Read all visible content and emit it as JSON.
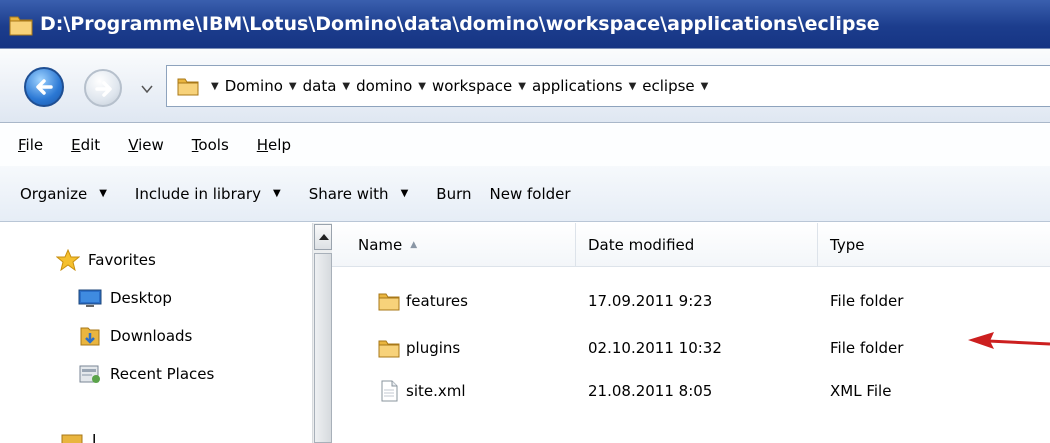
{
  "window": {
    "title": "D:\\Programme\\IBM\\Lotus\\Domino\\data\\domino\\workspace\\applications\\eclipse"
  },
  "address": {
    "breadcrumbs": [
      "Domino",
      "data",
      "domino",
      "workspace",
      "applications",
      "eclipse"
    ]
  },
  "menu": {
    "items": [
      {
        "label": "File",
        "accel": "F",
        "rest": "ile"
      },
      {
        "label": "Edit",
        "accel": "E",
        "rest": "dit"
      },
      {
        "label": "View",
        "accel": "V",
        "rest": "iew"
      },
      {
        "label": "Tools",
        "accel": "T",
        "rest": "ools"
      },
      {
        "label": "Help",
        "accel": "H",
        "rest": "elp"
      }
    ]
  },
  "toolbar": {
    "organize": "Organize",
    "include": "Include in library",
    "share": "Share with",
    "burn": "Burn",
    "new_folder": "New folder"
  },
  "navpane": {
    "favorites": "Favorites",
    "desktop": "Desktop",
    "downloads": "Downloads",
    "recent": "Recent Places",
    "partial": "L"
  },
  "filelist": {
    "columns": {
      "name": "Name",
      "date": "Date modified",
      "type": "Type"
    },
    "rows": [
      {
        "name": "features",
        "date": "17.09.2011 9:23",
        "type": "File folder",
        "icon": "folder-icon"
      },
      {
        "name": "plugins",
        "date": "02.10.2011 10:32",
        "type": "File folder",
        "icon": "folder-icon"
      },
      {
        "name": "site.xml",
        "date": "21.08.2011 8:05",
        "type": "XML File",
        "icon": "xml-file-icon"
      }
    ]
  },
  "colors": {
    "titlebar": "#1c3d8d",
    "annotation_arrow": "#cc1f1f"
  }
}
